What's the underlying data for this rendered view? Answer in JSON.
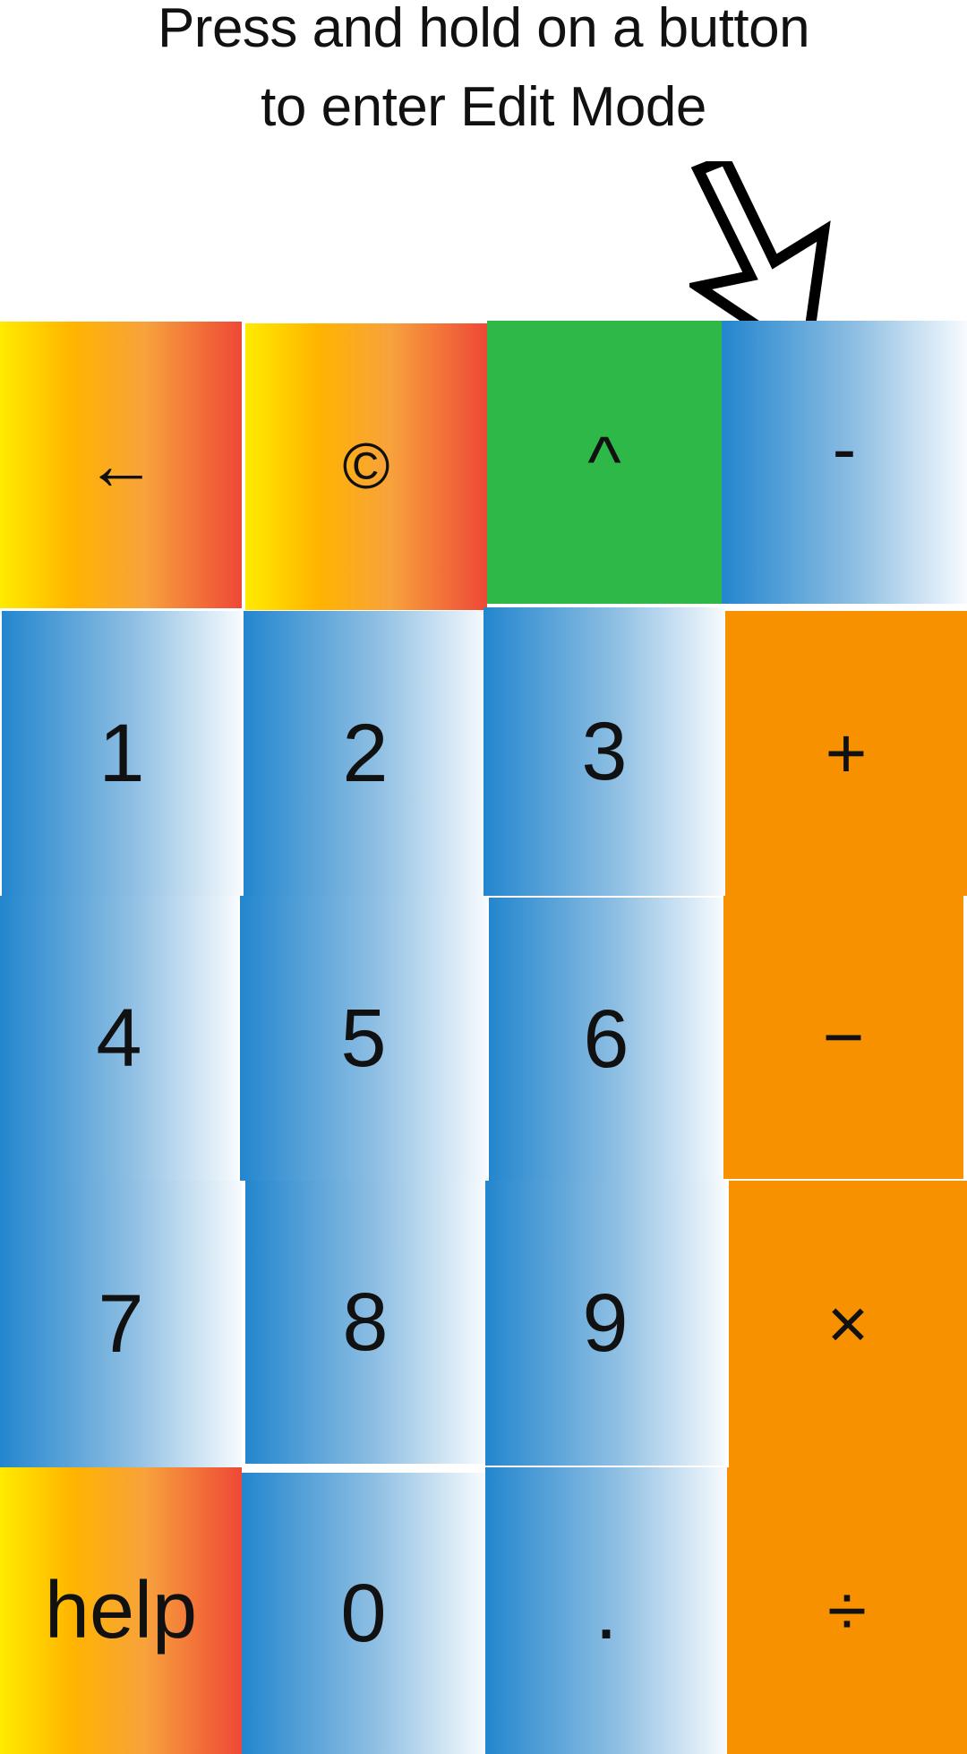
{
  "instruction": {
    "line1": "Press and hold on a button",
    "line2": "to enter Edit Mode"
  },
  "colors": {
    "warm_gradient": [
      "#ffeb00",
      "#ffb400",
      "#f7a23c",
      "#ee4836"
    ],
    "blue_gradient": [
      "#2386ce",
      "#8fbfe3",
      "#f7fbfe"
    ],
    "green": "#2eb847",
    "orange": "#f79100"
  },
  "keys": {
    "backspace": "←",
    "copyright": "©",
    "power": "^",
    "negate": "-",
    "one": "1",
    "two": "2",
    "three": "3",
    "plus": "+",
    "four": "4",
    "five": "5",
    "six": "6",
    "minus": "−",
    "seven": "7",
    "eight": "8",
    "nine": "9",
    "multiply": "×",
    "help": "help",
    "zero": "0",
    "decimal": ".",
    "divide": "÷"
  },
  "icons": {
    "pointer_arrow": "hollow-arrow-down-icon"
  }
}
